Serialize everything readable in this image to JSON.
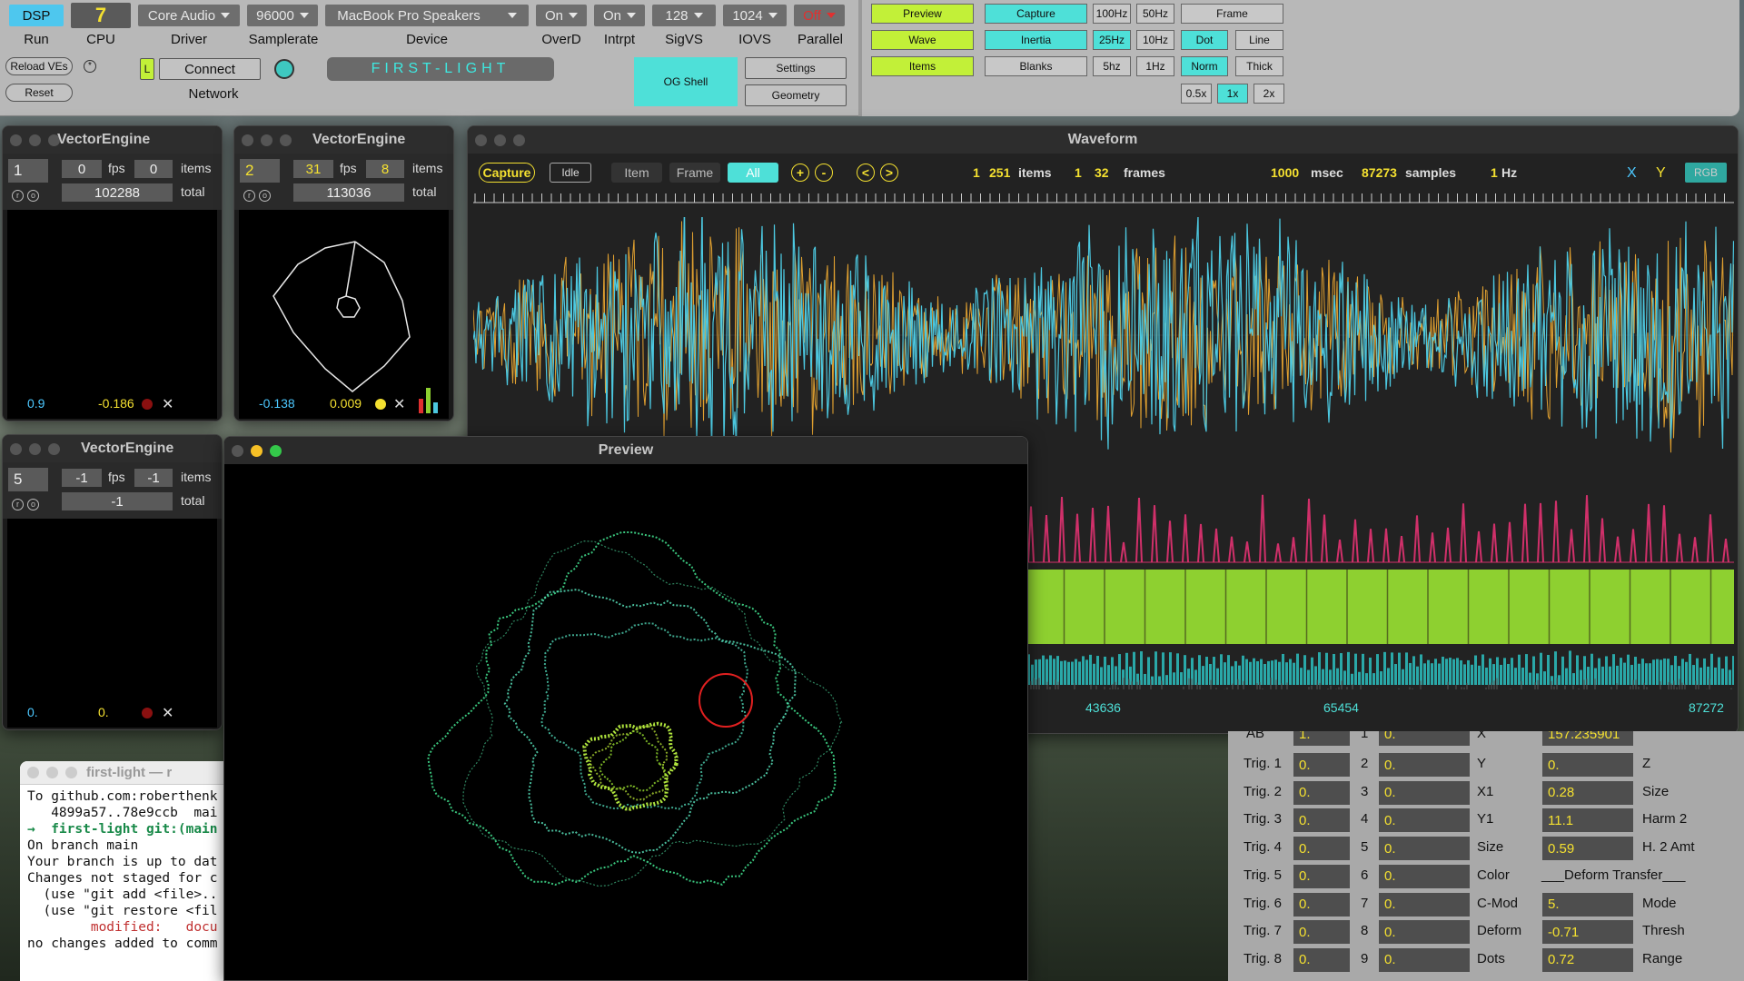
{
  "top": {
    "dsp": "DSP",
    "run": "Run",
    "cpu_value": "7",
    "cpu_label": "CPU",
    "driver_value": "Core Audio",
    "driver_label": "Driver",
    "samplerate_value": "96000",
    "samplerate_label": "Samplerate",
    "device_value": "MacBook Pro Speakers",
    "device_label": "Device",
    "overd_value": "On",
    "overd_label": "OverD",
    "intrpt_value": "On",
    "intrpt_label": "Intrpt",
    "sigvs_value": "128",
    "sigvs_label": "SigVS",
    "iovs_value": "1024",
    "iovs_label": "IOVS",
    "parallel_value": "Off",
    "parallel_label": "Parallel",
    "reload": "Reload VEs",
    "reset": "Reset",
    "l_btn": "L",
    "connect": "Connect",
    "network": "Network",
    "title": "FIRST-LIGHT",
    "og_shell": "OG Shell",
    "settings": "Settings",
    "geometry": "Geometry"
  },
  "right_panel": {
    "preview": "Preview",
    "wave": "Wave",
    "items": "Items",
    "capture": "Capture",
    "inertia": "Inertia",
    "blanks": "Blanks",
    "hz100": "100Hz",
    "hz50": "50Hz",
    "hz25": "25Hz",
    "hz10": "10Hz",
    "hz5": "5hz",
    "hz1": "1Hz",
    "frame": "Frame",
    "dot": "Dot",
    "line": "Line",
    "norm": "Norm",
    "thick": "Thick",
    "x05": "0.5x",
    "x1": "1x",
    "x2": "2x"
  },
  "ve1": {
    "title": "VectorEngine",
    "index": "1",
    "fps": "0",
    "items": "0",
    "total": "102288",
    "fps_lbl": "fps",
    "items_lbl": "items",
    "total_lbl": "total",
    "left_val": "0.9",
    "right_val": "-0.186"
  },
  "ve2": {
    "title": "VectorEngine",
    "index": "2",
    "fps": "31",
    "items": "8",
    "total": "113036",
    "fps_lbl": "fps",
    "items_lbl": "items",
    "total_lbl": "total",
    "left_val": "-0.138",
    "right_val": "0.009"
  },
  "ve5": {
    "title": "VectorEngine",
    "index": "5",
    "fps": "-1",
    "items": "-1",
    "total": "-1",
    "fps_lbl": "fps",
    "items_lbl": "items",
    "total_lbl": "total",
    "left_val": "0.",
    "right_val": "0."
  },
  "waveform": {
    "title": "Waveform",
    "capture": "Capture",
    "idle": "Idle",
    "item": "Item",
    "frame": "Frame",
    "all": "All",
    "plus": "+",
    "minus": "-",
    "prev": "<",
    "next": ">",
    "items_a": "1",
    "items_b": "251",
    "items_lbl": "items",
    "frames_a": "1",
    "frames_b": "32",
    "frames_lbl": "frames",
    "msec": "1000",
    "msec_lbl": "msec",
    "samples": "87273",
    "samples_lbl": "samples",
    "hz_val": "1",
    "hz_lbl": "Hz",
    "x": "X",
    "y": "Y",
    "rgb": "RGB",
    "marker1": "43636",
    "marker2": "65454",
    "marker3": "87272"
  },
  "preview": {
    "title": "Preview"
  },
  "table": {
    "header": {
      "ab": "AB",
      "ab_val": "1.",
      "n": "1",
      "n_val": "0.",
      "x": "X",
      "x_val": "157.235901"
    },
    "rows": [
      {
        "trig": "Trig. 1",
        "tv": "0.",
        "n": "2",
        "nv": "0.",
        "lbl": "Y",
        "val": "0.",
        "lbl2": "Z"
      },
      {
        "trig": "Trig. 2",
        "tv": "0.",
        "n": "3",
        "nv": "0.",
        "lbl": "X1",
        "val": "0.28",
        "lbl2": "Size"
      },
      {
        "trig": "Trig. 3",
        "tv": "0.",
        "n": "4",
        "nv": "0.",
        "lbl": "Y1",
        "val": "11.1",
        "lbl2": "Harm 2"
      },
      {
        "trig": "Trig. 4",
        "tv": "0.",
        "n": "5",
        "nv": "0.",
        "lbl": "Size",
        "val": "0.59",
        "lbl2": "H. 2 Amt"
      },
      {
        "trig": "Trig. 5",
        "tv": "0.",
        "n": "6",
        "nv": "0.",
        "lbl": "Color",
        "val": "",
        "lbl2": "___Deform Transfer___"
      },
      {
        "trig": "Trig. 6",
        "tv": "0.",
        "n": "7",
        "nv": "0.",
        "lbl": "C-Mod",
        "val": "5.",
        "lbl2": "Mode"
      },
      {
        "trig": "Trig. 7",
        "tv": "0.",
        "n": "8",
        "nv": "0.",
        "lbl": "Deform",
        "val": "-0.71",
        "lbl2": "Thresh"
      },
      {
        "trig": "Trig. 8",
        "tv": "0.",
        "n": "9",
        "nv": "0.",
        "lbl": "Dots",
        "val": "0.72",
        "lbl2": "Range"
      }
    ]
  },
  "terminal": {
    "title": "first-light — r",
    "lines": [
      "To github.com:roberthenk",
      "   4899a57..78e9ccb  mai",
      "→  first-light git:(main",
      "On branch main",
      "Your branch is up to dat",
      "",
      "Changes not staged for c",
      "  (use \"git add <file>..",
      "  (use \"git restore <fil",
      "        modified:   docu",
      "",
      "no changes added to comm"
    ]
  },
  "colors": {
    "lime": "#c2f038",
    "cyan": "#4ee0d8",
    "yellow": "#f4e030",
    "wave_cyan": "#4cc8e0",
    "wave_orange": "#e0a030",
    "trig_pink": "#d0306a",
    "trig_green": "#8ed030"
  }
}
